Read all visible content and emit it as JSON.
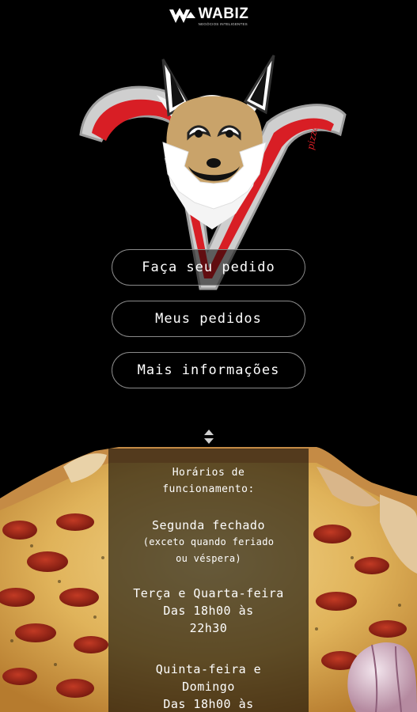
{
  "brand": {
    "name": "WABIZ",
    "tagline": "NEGÓCIOS INTELIGENTES"
  },
  "logo": {
    "description_icon": "fox-v-logo",
    "side_text": "pizzas",
    "colors": {
      "red": "#d81e25",
      "fox_tan": "#c9a36a",
      "outline": "#bdbdbd"
    }
  },
  "menu": {
    "order_label": "Faça seu pedido",
    "my_orders_label": "Meus pedidos",
    "more_info_label": "Mais informações"
  },
  "scroll_icon": "sort-arrows-icon",
  "hours": {
    "title_line1": "Horários de",
    "title_line2": "funcionamento:",
    "monday": "Segunda fechado",
    "monday_note_1": "(exceto quando feriado",
    "monday_note_2": "ou véspera)",
    "tue_wed": "Terça e Quarta-feira",
    "tue_wed_time_1": "Das 18h00 às",
    "tue_wed_time_2": "22h30",
    "thu_sun_1": "Quinta-feira e",
    "thu_sun_2": "Domingo",
    "thu_sun_time_1": "Das 18h00 às"
  }
}
